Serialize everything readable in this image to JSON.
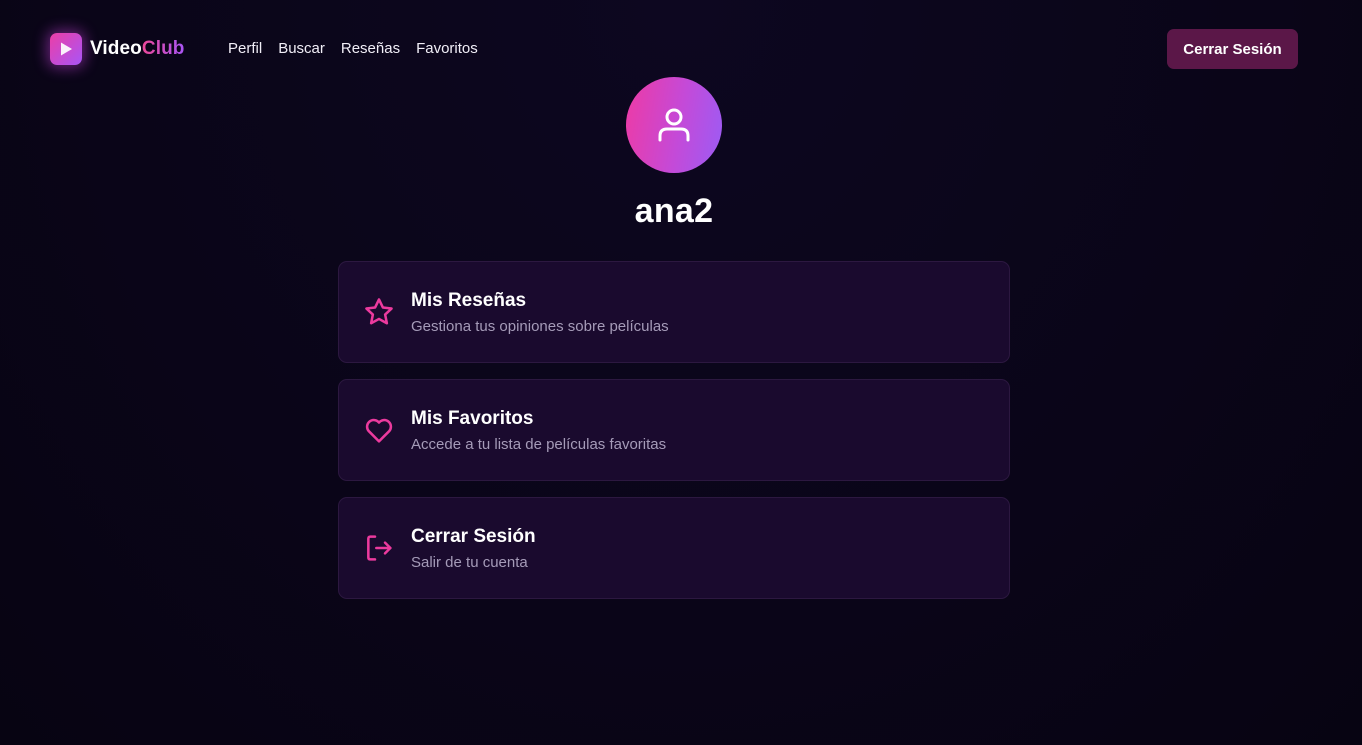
{
  "brand": {
    "name_part1": "Video",
    "name_part2": "Club",
    "logo_icon": "play-icon"
  },
  "nav": {
    "items": [
      "Perfil",
      "Buscar",
      "Reseñas",
      "Favoritos"
    ]
  },
  "header": {
    "logout_label": "Cerrar Sesión"
  },
  "profile": {
    "avatar_icon": "user-icon",
    "username": "ana2"
  },
  "cards": [
    {
      "icon": "star-icon",
      "title": "Mis Reseñas",
      "description": "Gestiona tus opiniones sobre películas"
    },
    {
      "icon": "heart-icon",
      "title": "Mis Favoritos",
      "description": "Accede a tu lista de películas favoritas"
    },
    {
      "icon": "logout-icon",
      "title": "Cerrar Sesión",
      "description": "Salir de tu cuenta"
    }
  ],
  "colors": {
    "background": "#0a0518",
    "accent_pink": "#ec4899",
    "accent_purple": "#a855f7",
    "card_background": "#1a0a2e",
    "logout_button": "#5b1748"
  }
}
